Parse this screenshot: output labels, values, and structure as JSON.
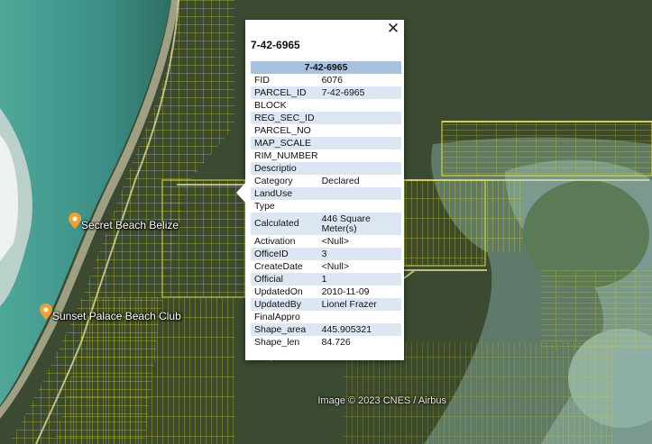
{
  "popup": {
    "title": "7-42-6965",
    "table_header": "7-42-6965",
    "close_icon": "close-icon",
    "rows": [
      {
        "key": "FID",
        "value": "6076"
      },
      {
        "key": "PARCEL_ID",
        "value": "7-42-6965"
      },
      {
        "key": "BLOCK",
        "value": ""
      },
      {
        "key": "REG_SEC_ID",
        "value": ""
      },
      {
        "key": "PARCEL_NO",
        "value": ""
      },
      {
        "key": "MAP_SCALE",
        "value": ""
      },
      {
        "key": "RIM_NUMBER",
        "value": ""
      },
      {
        "key": "Descriptio",
        "value": ""
      },
      {
        "key": "Category",
        "value": "Declared"
      },
      {
        "key": "LandUse",
        "value": ""
      },
      {
        "key": "Type",
        "value": ""
      },
      {
        "key": "Calculated",
        "value": "446 Square Meter(s)"
      },
      {
        "key": "Activation",
        "value": "<Null>"
      },
      {
        "key": "OfficeID",
        "value": "3"
      },
      {
        "key": "CreateDate",
        "value": "<Null>"
      },
      {
        "key": "Official",
        "value": "1"
      },
      {
        "key": "UpdatedOn",
        "value": "2010-11-09"
      },
      {
        "key": "UpdatedBy",
        "value": "Lionel Frazer"
      },
      {
        "key": "FinalAppro",
        "value": ""
      },
      {
        "key": "Shape_area",
        "value": "445.905321"
      },
      {
        "key": "Shape_len",
        "value": "84.726"
      }
    ]
  },
  "places": [
    {
      "name": "Secret Beach Belize",
      "icon": "map-pin-icon"
    },
    {
      "name": "Sunset Palace Beach Club",
      "icon": "map-pin-icon"
    }
  ],
  "credit": "Image © 2023 CNES / Airbus",
  "colors": {
    "parcel_lines": "#e6e62a",
    "pin": "#f0a030",
    "table_header": "#a8c1de",
    "row_alt": "#dde7f3"
  }
}
